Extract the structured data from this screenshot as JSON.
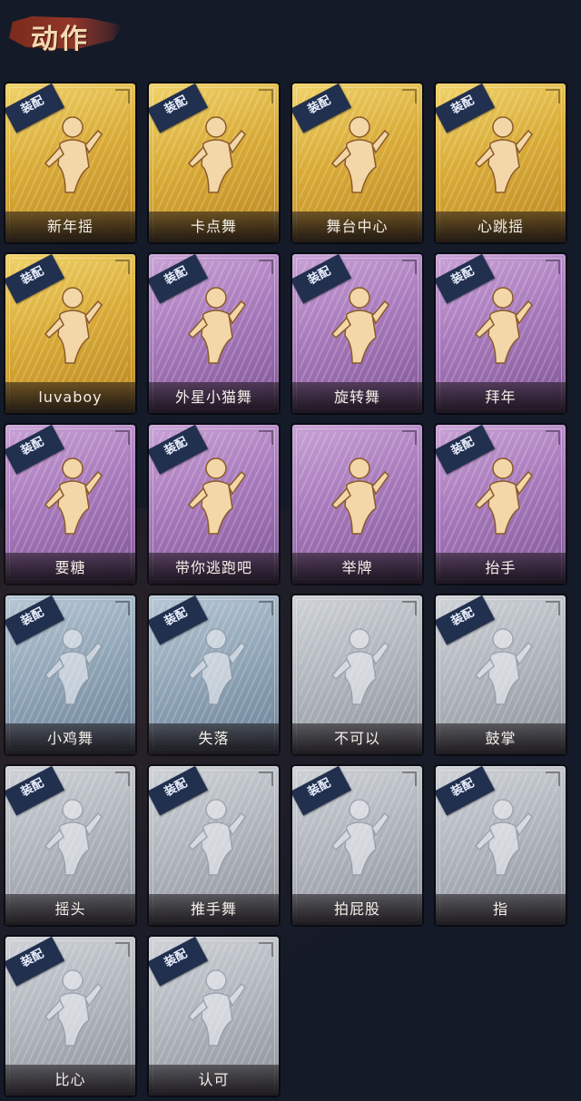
{
  "header": {
    "title": "动作"
  },
  "equip_tag": "装配",
  "rarity_colors": {
    "gold": "#d9ab36",
    "purple": "#a779bb",
    "blue": "#8ea3b5",
    "white": "#aeb3ba"
  },
  "cards": [
    {
      "label": "新年摇",
      "rarity": "gold",
      "equip": true,
      "icon": "dance-figure-icon"
    },
    {
      "label": "卡点舞",
      "rarity": "gold",
      "equip": true,
      "icon": "pointing-dance-icon"
    },
    {
      "label": "舞台中心",
      "rarity": "gold",
      "equip": true,
      "icon": "center-stage-icon"
    },
    {
      "label": "心跳摇",
      "rarity": "gold",
      "equip": true,
      "icon": "heartbeat-dance-icon"
    },
    {
      "label": "luvaboy",
      "rarity": "gold",
      "equip": true,
      "icon": "luvaboy-dance-icon"
    },
    {
      "label": "外星小猫舞",
      "rarity": "purple",
      "equip": true,
      "icon": "alien-cat-dance-icon"
    },
    {
      "label": "旋转舞",
      "rarity": "purple",
      "equip": true,
      "icon": "spin-dance-icon"
    },
    {
      "label": "拜年",
      "rarity": "purple",
      "equip": true,
      "icon": "new-year-greeting-icon"
    },
    {
      "label": "要糖",
      "rarity": "purple",
      "equip": true,
      "icon": "ask-candy-icon"
    },
    {
      "label": "带你逃跑吧",
      "rarity": "purple",
      "equip": true,
      "icon": "run-away-dance-icon"
    },
    {
      "label": "举牌",
      "rarity": "purple",
      "equip": false,
      "icon": "hold-sign-icon"
    },
    {
      "label": "抬手",
      "rarity": "purple",
      "equip": true,
      "icon": "raise-hand-icon"
    },
    {
      "label": "小鸡舞",
      "rarity": "blue",
      "equip": true,
      "icon": "chicken-dance-icon"
    },
    {
      "label": "失落",
      "rarity": "blue",
      "equip": true,
      "icon": "crawl-sad-icon"
    },
    {
      "label": "不可以",
      "rarity": "white",
      "equip": false,
      "icon": "finger-wag-icon"
    },
    {
      "label": "鼓掌",
      "rarity": "white",
      "equip": true,
      "icon": "clap-icon"
    },
    {
      "label": "摇头",
      "rarity": "white",
      "equip": true,
      "icon": "shake-head-icon"
    },
    {
      "label": "推手舞",
      "rarity": "white",
      "equip": true,
      "icon": "push-hand-dance-icon"
    },
    {
      "label": "拍屁股",
      "rarity": "white",
      "equip": true,
      "icon": "slap-butt-icon"
    },
    {
      "label": "指",
      "rarity": "white",
      "equip": true,
      "icon": "point-finger-icon"
    },
    {
      "label": "比心",
      "rarity": "white",
      "equip": true,
      "icon": "finger-heart-icon"
    },
    {
      "label": "认可",
      "rarity": "white",
      "equip": true,
      "icon": "thumbs-up-icon"
    }
  ]
}
